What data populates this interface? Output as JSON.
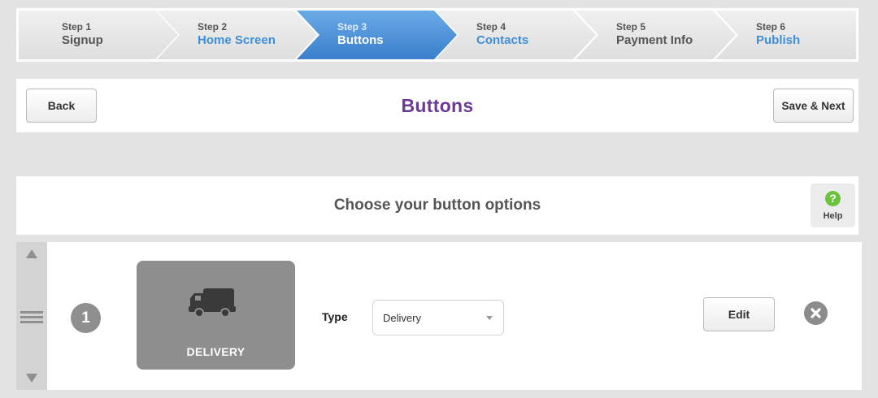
{
  "wizard": {
    "steps": [
      {
        "num": "Step 1",
        "name": "Signup"
      },
      {
        "num": "Step 2",
        "name": "Home Screen"
      },
      {
        "num": "Step 3",
        "name": "Buttons"
      },
      {
        "num": "Step 4",
        "name": "Contacts"
      },
      {
        "num": "Step 5",
        "name": "Payment Info"
      },
      {
        "num": "Step 6",
        "name": "Publish"
      }
    ],
    "active_step": 3
  },
  "header": {
    "back_label": "Back",
    "title": "Buttons",
    "save_label": "Save & Next"
  },
  "options": {
    "title": "Choose your button options",
    "help_label": "Help",
    "help_glyph": "?"
  },
  "button_row": {
    "number": "1",
    "preview_label": "DELIVERY",
    "preview_icon": "truck-icon",
    "type_label": "Type",
    "type_value": "Delivery",
    "edit_label": "Edit",
    "remove_icon": "close-circle-icon"
  },
  "colors": {
    "active_step": "#4a8fdb",
    "link_step": "#3f8fd8",
    "title": "#6a3a94",
    "help_icon": "#6cc23a",
    "tile": "#8e8e8e"
  }
}
